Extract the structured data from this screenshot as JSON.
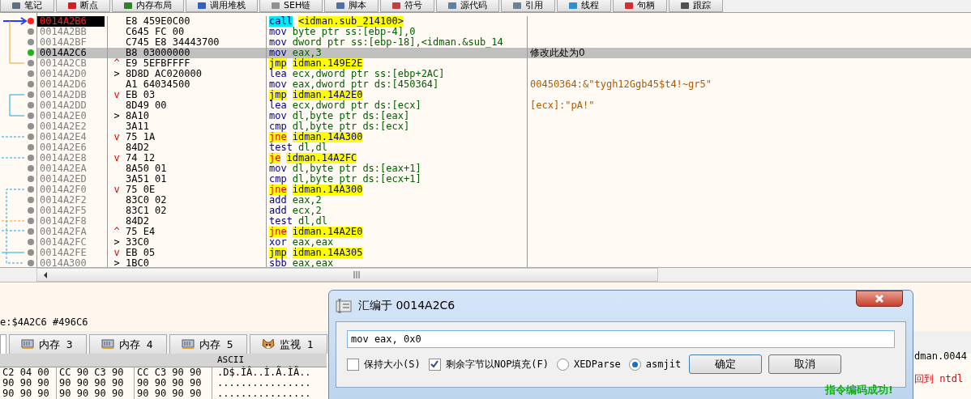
{
  "top_tabs": [
    {
      "label": "笔记",
      "selected": false
    },
    {
      "label": "断点",
      "selected": false
    },
    {
      "label": "内存布局",
      "selected": false
    },
    {
      "label": "调用堆栈",
      "selected": false
    },
    {
      "label": "SEH链",
      "selected": false
    },
    {
      "label": "脚本",
      "selected": false
    },
    {
      "label": "符号",
      "selected": false
    },
    {
      "label": "源代码",
      "selected": false
    },
    {
      "label": "引用",
      "selected": false
    },
    {
      "label": "线程",
      "selected": false
    },
    {
      "label": "句柄",
      "selected": false
    },
    {
      "label": "跟踪",
      "selected": false
    }
  ],
  "disassembly": {
    "rows": [
      {
        "address": "0014A2B6",
        "bytes": "E8 459E0C00",
        "mnemonic": "call",
        "operands": "<idman.sub_214100>",
        "kind": "call",
        "breakpoint": true,
        "selected": false
      },
      {
        "address": "0014A2BB",
        "bytes": "C645 FC 00",
        "mnemonic": "mov",
        "operands": "byte ptr ss:[ebp-4],0",
        "kind": "plain",
        "breakpoint": false,
        "selected": false
      },
      {
        "address": "0014A2BF",
        "bytes": "C745 E8 34443700",
        "mnemonic": "mov",
        "operands": "dword ptr ss:[ebp-18],<idman.&sub_14",
        "kind": "plain",
        "breakpoint": false,
        "selected": false
      },
      {
        "address": "0014A2C6",
        "bytes": "B8 03000000",
        "mnemonic": "mov",
        "operands": "eax,3",
        "kind": "plain",
        "breakpoint": false,
        "selected": true,
        "comment": {
          "text": "修改此处为0",
          "kind": "user"
        }
      },
      {
        "address": "0014A2CB",
        "marker": {
          "symbol": "^",
          "kind": "jump"
        },
        "bytes": "E9 5EFBFFFF",
        "mnemonic": "jmp",
        "operands": "idman.149E2E",
        "kind": "jmp",
        "breakpoint": false,
        "selected": false
      },
      {
        "address": "0014A2D0",
        "marker": {
          "symbol": ">",
          "kind": "target"
        },
        "bytes": "8D8D AC020000",
        "mnemonic": "lea",
        "operands": "ecx,dword ptr ss:[ebp+2AC]",
        "kind": "plain",
        "breakpoint": false,
        "selected": false
      },
      {
        "address": "0014A2D6",
        "bytes": "A1 64034500",
        "mnemonic": "mov",
        "operands": "eax,dword ptr ds:[450364]",
        "kind": "plain",
        "breakpoint": false,
        "selected": false,
        "comment": {
          "text": "00450364:&\"tygh12Ggb45$t4!~gr5\"",
          "kind": "auto"
        }
      },
      {
        "address": "0014A2DB",
        "marker": {
          "symbol": "v",
          "kind": "jump"
        },
        "bytes": "EB 03",
        "mnemonic": "jmp",
        "operands": "idman.14A2E0",
        "kind": "jmp",
        "breakpoint": false,
        "selected": false
      },
      {
        "address": "0014A2DD",
        "bytes": "8D49 00",
        "mnemonic": "lea",
        "operands": "ecx,dword ptr ds:[ecx]",
        "kind": "plain",
        "breakpoint": false,
        "selected": false,
        "comment": {
          "text": "[ecx]:\"pA!\"",
          "kind": "auto"
        }
      },
      {
        "address": "0014A2E0",
        "marker": {
          "symbol": ">",
          "kind": "target"
        },
        "bytes": "8A10",
        "mnemonic": "mov",
        "operands": "dl,byte ptr ds:[eax]",
        "kind": "plain",
        "breakpoint": false,
        "selected": false
      },
      {
        "address": "0014A2E2",
        "bytes": "3A11",
        "mnemonic": "cmp",
        "operands": "dl,byte ptr ds:[ecx]",
        "kind": "plain",
        "breakpoint": false,
        "selected": false
      },
      {
        "address": "0014A2E4",
        "marker": {
          "symbol": "v",
          "kind": "jump"
        },
        "bytes": "75 1A",
        "mnemonic": "jne",
        "operands": "idman.14A300",
        "kind": "jcc",
        "breakpoint": false,
        "selected": false
      },
      {
        "address": "0014A2E6",
        "bytes": "84D2",
        "mnemonic": "test",
        "operands": "dl,dl",
        "kind": "plain",
        "breakpoint": false,
        "selected": false
      },
      {
        "address": "0014A2E8",
        "marker": {
          "symbol": "v",
          "kind": "jump"
        },
        "bytes": "74 12",
        "mnemonic": "je",
        "operands": "idman.14A2FC",
        "kind": "jcc",
        "breakpoint": false,
        "selected": false
      },
      {
        "address": "0014A2EA",
        "bytes": "8A50 01",
        "mnemonic": "mov",
        "operands": "dl,byte ptr ds:[eax+1]",
        "kind": "plain",
        "breakpoint": false,
        "selected": false
      },
      {
        "address": "0014A2ED",
        "bytes": "3A51 01",
        "mnemonic": "cmp",
        "operands": "dl,byte ptr ds:[ecx+1]",
        "kind": "plain",
        "breakpoint": false,
        "selected": false
      },
      {
        "address": "0014A2F0",
        "marker": {
          "symbol": "v",
          "kind": "jump"
        },
        "bytes": "75 0E",
        "mnemonic": "jne",
        "operands": "idman.14A300",
        "kind": "jcc",
        "breakpoint": false,
        "selected": false
      },
      {
        "address": "0014A2F2",
        "bytes": "83C0 02",
        "mnemonic": "add",
        "operands": "eax,2",
        "kind": "plain",
        "breakpoint": false,
        "selected": false
      },
      {
        "address": "0014A2F5",
        "bytes": "83C1 02",
        "mnemonic": "add",
        "operands": "ecx,2",
        "kind": "plain",
        "breakpoint": false,
        "selected": false
      },
      {
        "address": "0014A2F8",
        "bytes": "84D2",
        "mnemonic": "test",
        "operands": "dl,dl",
        "kind": "plain",
        "breakpoint": false,
        "selected": false
      },
      {
        "address": "0014A2FA",
        "marker": {
          "symbol": "^",
          "kind": "jump"
        },
        "bytes": "75 E4",
        "mnemonic": "jne",
        "operands": "idman.14A2E0",
        "kind": "jcc",
        "breakpoint": false,
        "selected": false
      },
      {
        "address": "0014A2FC",
        "marker": {
          "symbol": ">",
          "kind": "target"
        },
        "bytes": "33C0",
        "mnemonic": "xor",
        "operands": "eax,eax",
        "kind": "plain",
        "breakpoint": false,
        "selected": false
      },
      {
        "address": "0014A2FE",
        "marker": {
          "symbol": "v",
          "kind": "jump"
        },
        "bytes": "EB 05",
        "mnemonic": "jmp",
        "operands": "idman.14A305",
        "kind": "jmp",
        "breakpoint": false,
        "selected": false
      },
      {
        "address": "0014A300",
        "marker": {
          "symbol": ">",
          "kind": "target"
        },
        "bytes": "1BC0",
        "mnemonic": "sbb",
        "operands": "eax,eax",
        "kind": "plain",
        "breakpoint": false,
        "selected": false
      }
    ]
  },
  "info_panel": {
    "text": "e:$4A2C6 #496C6"
  },
  "bottom_tabs": [
    {
      "kind": "blank",
      "selected": true
    },
    {
      "label": "内存 3",
      "kind": "memory",
      "selected": false
    },
    {
      "label": "内存 4",
      "kind": "memory",
      "selected": false
    },
    {
      "label": "内存 5",
      "kind": "memory",
      "selected": false
    },
    {
      "label": "监视 1",
      "kind": "watch",
      "selected": false
    }
  ],
  "dump": {
    "ascii_header": "ASCII",
    "rows": [
      {
        "groups": [
          "C2 04 00",
          "CC 90 C3 90",
          "CC C3 90 90"
        ],
        "ascii": ".D$.ÌÂ..Ì.Ã.ÌÃ.."
      },
      {
        "groups": [
          "90 90 90",
          "90 90 90 90",
          "90 90 90 90"
        ],
        "ascii": "................"
      },
      {
        "groups": [
          "90 90 90",
          "90 90 90 90",
          "90 90 90 90"
        ],
        "ascii": "................"
      }
    ]
  },
  "side_texts": [
    {
      "text": "dman.0044",
      "kind": "normal"
    },
    {
      "text": "回到 ntdl",
      "kind": "return"
    }
  ],
  "dialog": {
    "title": "汇编于 0014A2C6",
    "value": "mov eax, 0x0",
    "checkboxes": [
      {
        "label": "保持大小(S)",
        "checked": false
      },
      {
        "label": "剩余字节以NOP填充(F)",
        "checked": true
      }
    ],
    "radios": [
      {
        "label": "XEDParse",
        "selected": false
      },
      {
        "label": "asmjit",
        "selected": true
      }
    ],
    "buttons": [
      "确定",
      "取消"
    ],
    "status": "指令编码成功!"
  }
}
